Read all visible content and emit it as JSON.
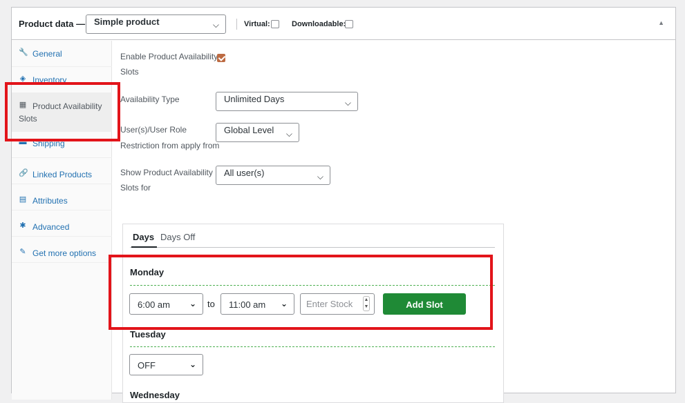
{
  "header": {
    "title": "Product data —",
    "product_type": "Simple product",
    "virtual_label": "Virtual:",
    "virtual_checked": false,
    "downloadable_label": "Downloadable:",
    "downloadable_checked": false
  },
  "sidebar": {
    "items": [
      {
        "label": "General",
        "icon": "wrench-icon",
        "glyph": "🔧"
      },
      {
        "label": "Inventory",
        "icon": "tag-icon",
        "glyph": "◈"
      },
      {
        "label": "Product Availability",
        "label2": "Slots",
        "icon": "calendar-icon",
        "glyph": "▦",
        "active": true
      },
      {
        "label": "Shipping",
        "icon": "truck-icon",
        "glyph": "▬"
      },
      {
        "label": "Linked Products",
        "icon": "link-icon",
        "glyph": "🔗"
      },
      {
        "label": "Attributes",
        "icon": "list-icon",
        "glyph": "▤"
      },
      {
        "label": "Advanced",
        "icon": "gear-icon",
        "glyph": "✱"
      },
      {
        "label": "Get more options",
        "icon": "plugin-icon",
        "glyph": "✎"
      }
    ]
  },
  "fields": {
    "enable_label_1": "Enable Product Availability",
    "enable_label_2": "Slots",
    "enable_checked": true,
    "availability_type_label": "Availability Type",
    "availability_type_value": "Unlimited Days",
    "user_role_label_1": "User(s)/User Role",
    "user_role_label_2": "Restriction from apply from",
    "user_role_value": "Global Level",
    "show_for_label_1": "Show Product Availability",
    "show_for_label_2": "Slots for",
    "show_for_value": "All user(s)"
  },
  "slots": {
    "tabs": [
      "Days",
      "Days Off"
    ],
    "monday": {
      "name": "Monday",
      "from": "6:00 am",
      "to_label": "to",
      "to": "11:00 am",
      "stock_placeholder": "Enter Stock",
      "add_button": "Add Slot"
    },
    "tuesday": {
      "name": "Tuesday",
      "value": "OFF"
    },
    "wednesday": {
      "name": "Wednesday"
    }
  },
  "colors": {
    "highlight": "#e2141a",
    "add_button": "#1f8a36",
    "link": "#2271b1",
    "checkbox_checked": "#bd6b42"
  }
}
